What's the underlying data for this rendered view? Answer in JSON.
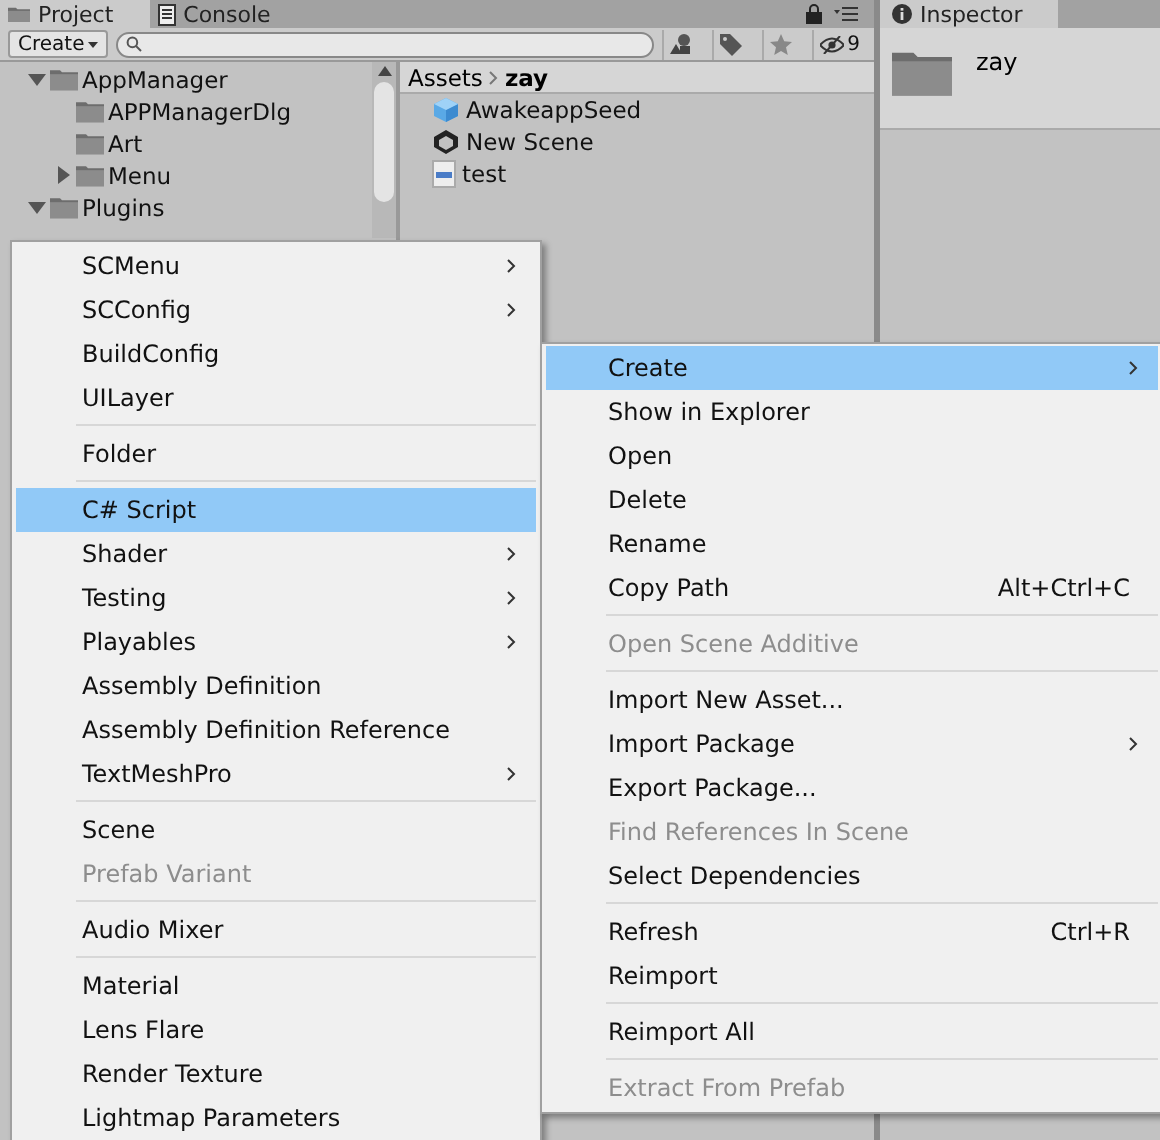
{
  "tabs": [
    {
      "label": "Project",
      "selected": true
    },
    {
      "label": "Console",
      "selected": false
    }
  ],
  "toolbar": {
    "create_label": "Create",
    "hidden_count": "9"
  },
  "tree": [
    {
      "label": "AppManager",
      "expanded": true,
      "children": [
        {
          "label": "APPManagerDlg"
        },
        {
          "label": "Art"
        },
        {
          "label": "Menu",
          "expanded": false
        }
      ]
    },
    {
      "label": "Plugins",
      "expanded": true
    }
  ],
  "breadcrumb": [
    "Assets",
    "zay"
  ],
  "files": [
    {
      "name": "AwakeappSeed",
      "kind": "prefab"
    },
    {
      "name": "New Scene",
      "kind": "scene"
    },
    {
      "name": "test",
      "kind": "script"
    }
  ],
  "inspector": {
    "tab": "Inspector",
    "name": "zay"
  },
  "submenu": [
    {
      "kind": "item",
      "label": "SCMenu",
      "submenu": true,
      "disabled": false,
      "selected": false
    },
    {
      "kind": "item",
      "label": "SCConfig",
      "submenu": true,
      "disabled": false,
      "selected": false
    },
    {
      "kind": "item",
      "label": "BuildConfig",
      "submenu": false,
      "disabled": false,
      "selected": false
    },
    {
      "kind": "item",
      "label": "UILayer",
      "submenu": false,
      "disabled": false,
      "selected": false
    },
    {
      "kind": "separator"
    },
    {
      "kind": "item",
      "label": "Folder",
      "submenu": false,
      "disabled": false,
      "selected": false
    },
    {
      "kind": "separator"
    },
    {
      "kind": "item",
      "label": "C# Script",
      "submenu": false,
      "disabled": false,
      "selected": true
    },
    {
      "kind": "item",
      "label": "Shader",
      "submenu": true,
      "disabled": false,
      "selected": false
    },
    {
      "kind": "item",
      "label": "Testing",
      "submenu": true,
      "disabled": false,
      "selected": false
    },
    {
      "kind": "item",
      "label": "Playables",
      "submenu": true,
      "disabled": false,
      "selected": false
    },
    {
      "kind": "item",
      "label": "Assembly Definition",
      "submenu": false,
      "disabled": false,
      "selected": false
    },
    {
      "kind": "item",
      "label": "Assembly Definition Reference",
      "submenu": false,
      "disabled": false,
      "selected": false
    },
    {
      "kind": "item",
      "label": "TextMeshPro",
      "submenu": true,
      "disabled": false,
      "selected": false
    },
    {
      "kind": "separator"
    },
    {
      "kind": "item",
      "label": "Scene",
      "submenu": false,
      "disabled": false,
      "selected": false
    },
    {
      "kind": "item",
      "label": "Prefab Variant",
      "submenu": false,
      "disabled": true,
      "selected": false
    },
    {
      "kind": "separator"
    },
    {
      "kind": "item",
      "label": "Audio Mixer",
      "submenu": false,
      "disabled": false,
      "selected": false
    },
    {
      "kind": "separator"
    },
    {
      "kind": "item",
      "label": "Material",
      "submenu": false,
      "disabled": false,
      "selected": false
    },
    {
      "kind": "item",
      "label": "Lens Flare",
      "submenu": false,
      "disabled": false,
      "selected": false
    },
    {
      "kind": "item",
      "label": "Render Texture",
      "submenu": false,
      "disabled": false,
      "selected": false
    },
    {
      "kind": "item",
      "label": "Lightmap Parameters",
      "submenu": false,
      "disabled": false,
      "selected": false
    }
  ],
  "context_menu": [
    {
      "kind": "item",
      "label": "Create",
      "submenu": true,
      "disabled": false,
      "selected": true
    },
    {
      "kind": "item",
      "label": "Show in Explorer",
      "submenu": false,
      "disabled": false,
      "selected": false
    },
    {
      "kind": "item",
      "label": "Open",
      "submenu": false,
      "disabled": false,
      "selected": false
    },
    {
      "kind": "item",
      "label": "Delete",
      "submenu": false,
      "disabled": false,
      "selected": false
    },
    {
      "kind": "item",
      "label": "Rename",
      "submenu": false,
      "disabled": false,
      "selected": false
    },
    {
      "kind": "item",
      "label": "Copy Path",
      "shortcut": "Alt+Ctrl+C",
      "submenu": false,
      "disabled": false,
      "selected": false
    },
    {
      "kind": "separator"
    },
    {
      "kind": "item",
      "label": "Open Scene Additive",
      "submenu": false,
      "disabled": true,
      "selected": false
    },
    {
      "kind": "separator"
    },
    {
      "kind": "item",
      "label": "Import New Asset...",
      "submenu": false,
      "disabled": false,
      "selected": false
    },
    {
      "kind": "item",
      "label": "Import Package",
      "submenu": true,
      "disabled": false,
      "selected": false
    },
    {
      "kind": "item",
      "label": "Export Package...",
      "submenu": false,
      "disabled": false,
      "selected": false
    },
    {
      "kind": "item",
      "label": "Find References In Scene",
      "submenu": false,
      "disabled": true,
      "selected": false
    },
    {
      "kind": "item",
      "label": "Select Dependencies",
      "submenu": false,
      "disabled": false,
      "selected": false
    },
    {
      "kind": "separator"
    },
    {
      "kind": "item",
      "label": "Refresh",
      "shortcut": "Ctrl+R",
      "submenu": false,
      "disabled": false,
      "selected": false
    },
    {
      "kind": "item",
      "label": "Reimport",
      "submenu": false,
      "disabled": false,
      "selected": false
    },
    {
      "kind": "separator"
    },
    {
      "kind": "item",
      "label": "Reimport All",
      "submenu": false,
      "disabled": false,
      "selected": false
    },
    {
      "kind": "separator"
    },
    {
      "kind": "item",
      "label": "Extract From Prefab",
      "submenu": false,
      "disabled": true,
      "selected": false
    }
  ]
}
